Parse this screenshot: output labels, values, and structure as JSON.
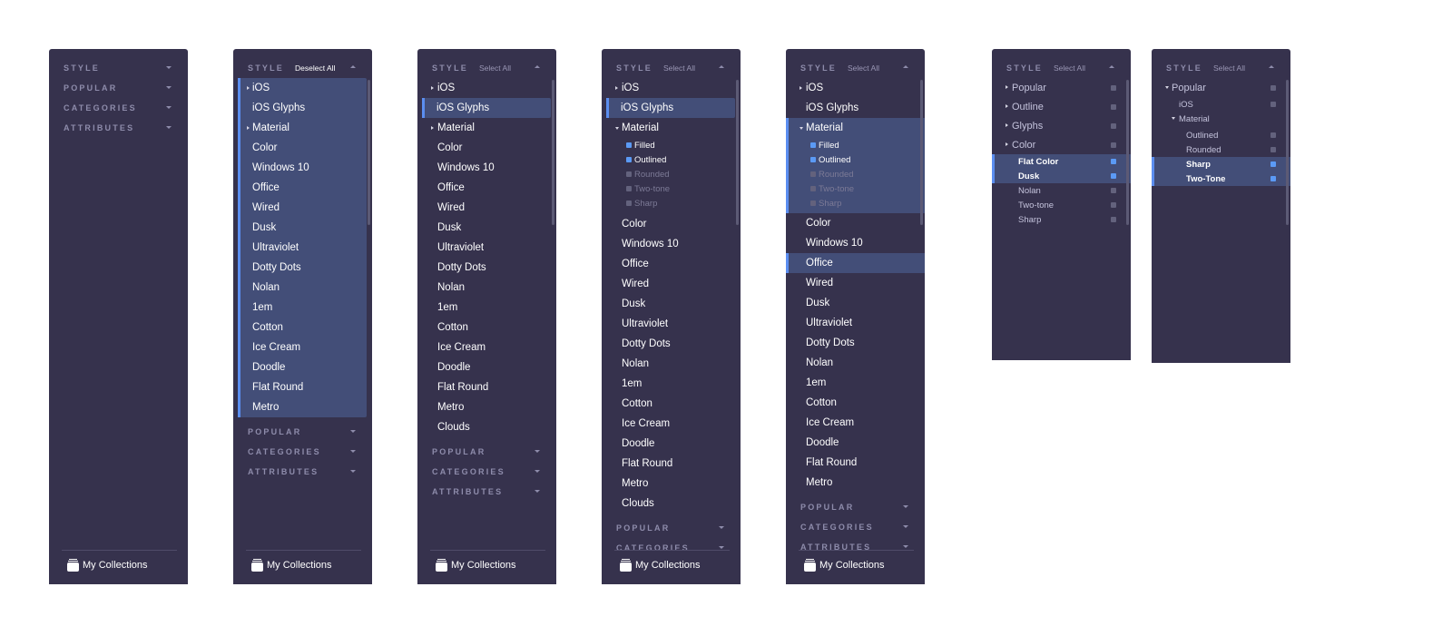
{
  "sections": {
    "style": "STYLE",
    "popular": "POPULAR",
    "categories": "CATEGORIES",
    "attributes": "ATTRIBUTES"
  },
  "actions": {
    "deselect_all": "Deselect All",
    "select_all": "Select All"
  },
  "footer": {
    "my_collections": "My Collections",
    "icon": "collections-icon"
  },
  "colors": {
    "panel_bg": "#36324d",
    "selection_bg": "#434e78",
    "accent": "#5b8ef0",
    "section_title": "#8e8cab"
  },
  "style_list": [
    "iOS",
    "iOS Glyphs",
    "Material",
    "Color",
    "Windows 10",
    "Office",
    "Wired",
    "Dusk",
    "Ultraviolet",
    "Dotty Dots",
    "Nolan",
    "1em",
    "Cotton",
    "Ice Cream",
    "Doodle",
    "Flat Round",
    "Metro",
    "Clouds"
  ],
  "material_sub": [
    "Filled",
    "Outlined",
    "Rounded",
    "Two-tone",
    "Sharp"
  ],
  "panel6": {
    "groups": [
      "Popular",
      "Outline",
      "Glyphs",
      "Color"
    ],
    "color_sub": [
      "Flat Color",
      "Dusk",
      "Nolan",
      "Two-tone",
      "Sharp"
    ]
  },
  "panel7": {
    "root": "Popular",
    "child": "iOS",
    "material": "Material",
    "material_sub": [
      "Outlined",
      "Rounded",
      "Sharp",
      "Two-Tone"
    ]
  }
}
